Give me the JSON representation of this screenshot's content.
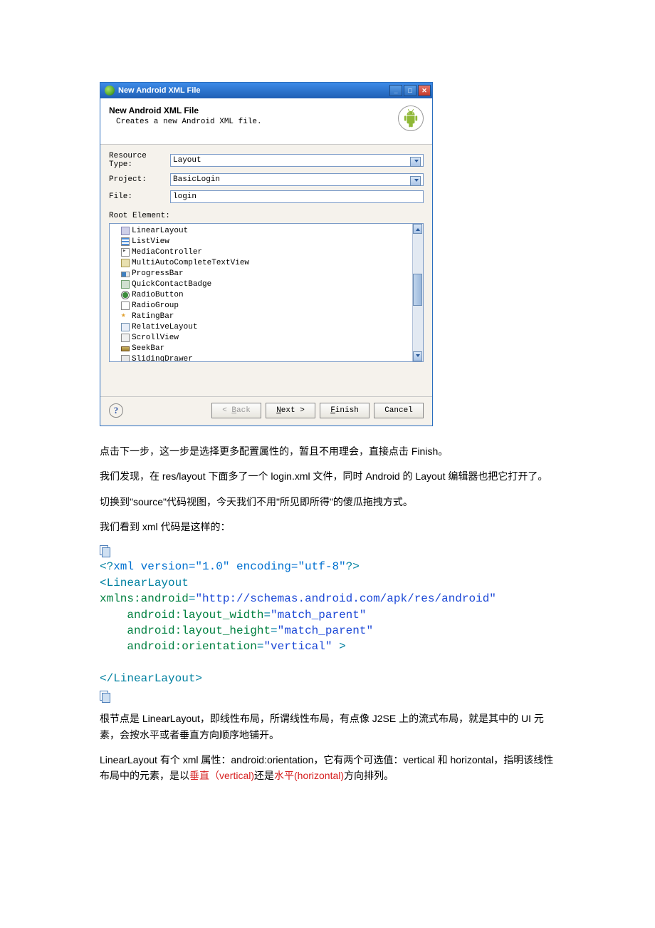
{
  "dialog": {
    "title": "New Android XML File",
    "header_title": "New Android XML File",
    "header_sub": "Creates a new Android XML file.",
    "labels": {
      "resource_type": "Resource Type:",
      "project": "Project:",
      "file": "File:",
      "root_element": "Root Element:"
    },
    "values": {
      "resource_type": "Layout",
      "project": "BasicLogin",
      "file": "login"
    },
    "root_items": [
      "LinearLayout",
      "ListView",
      "MediaController",
      "MultiAutoCompleteTextView",
      "ProgressBar",
      "QuickContactBadge",
      "RadioButton",
      "RadioGroup",
      "RatingBar",
      "RelativeLayout",
      "ScrollView",
      "SeekBar",
      "SlidingDrawer"
    ],
    "buttons": {
      "back": "< Back",
      "next": "Next >",
      "finish": "Finish",
      "cancel": "Cancel"
    }
  },
  "paragraphs": {
    "p1": "点击下一步，这一步是选择更多配置属性的，暂且不用理会，直接点击 Finish。",
    "p2": "我们发现，在 res/layout 下面多了一个 login.xml 文件，同时 Android 的 Layout 编辑器也把它打开了。",
    "p3": "切换到\"source\"代码视图，今天我们不用\"所见即所得\"的傻瓜拖拽方式。",
    "p4": "我们看到 xml 代码是这样的：",
    "p5": "根节点是 LinearLayout，即线性布局，所谓线性布局，有点像 J2SE 上的流式布局，就是其中的 UI 元素，会按水平或者垂直方向顺序地铺开。",
    "p6a": "LinearLayout 有个 xml 属性：android:orientation，它有两个可选值：vertical 和 horizontal，指明该线性布局中的元素，是以",
    "p6b": "垂直（vertical)",
    "p6c": "还是",
    "p6d": "水平(horizontal)",
    "p6e": "方向排列。"
  },
  "code": {
    "l1_a": "<?",
    "l1_b": "xml version=\"1.0\" encoding=\"utf-8\"",
    "l1_c": "?>",
    "l2": "<LinearLayout",
    "l3_a": "xmlns:android",
    "l3_b": "=",
    "l3_c": "\"http://schemas.android.com/apk/res/android\"",
    "l4_a": "    android:layout_width",
    "l4_b": "=",
    "l4_c": "\"match_parent\"",
    "l5_a": "    android:layout_height",
    "l5_b": "=",
    "l5_c": "\"match_parent\"",
    "l6_a": "    android:orientation",
    "l6_b": "=",
    "l6_c": "\"vertical\"",
    "l6_d": " >",
    "l7": "",
    "l8": "</LinearLayout>"
  }
}
